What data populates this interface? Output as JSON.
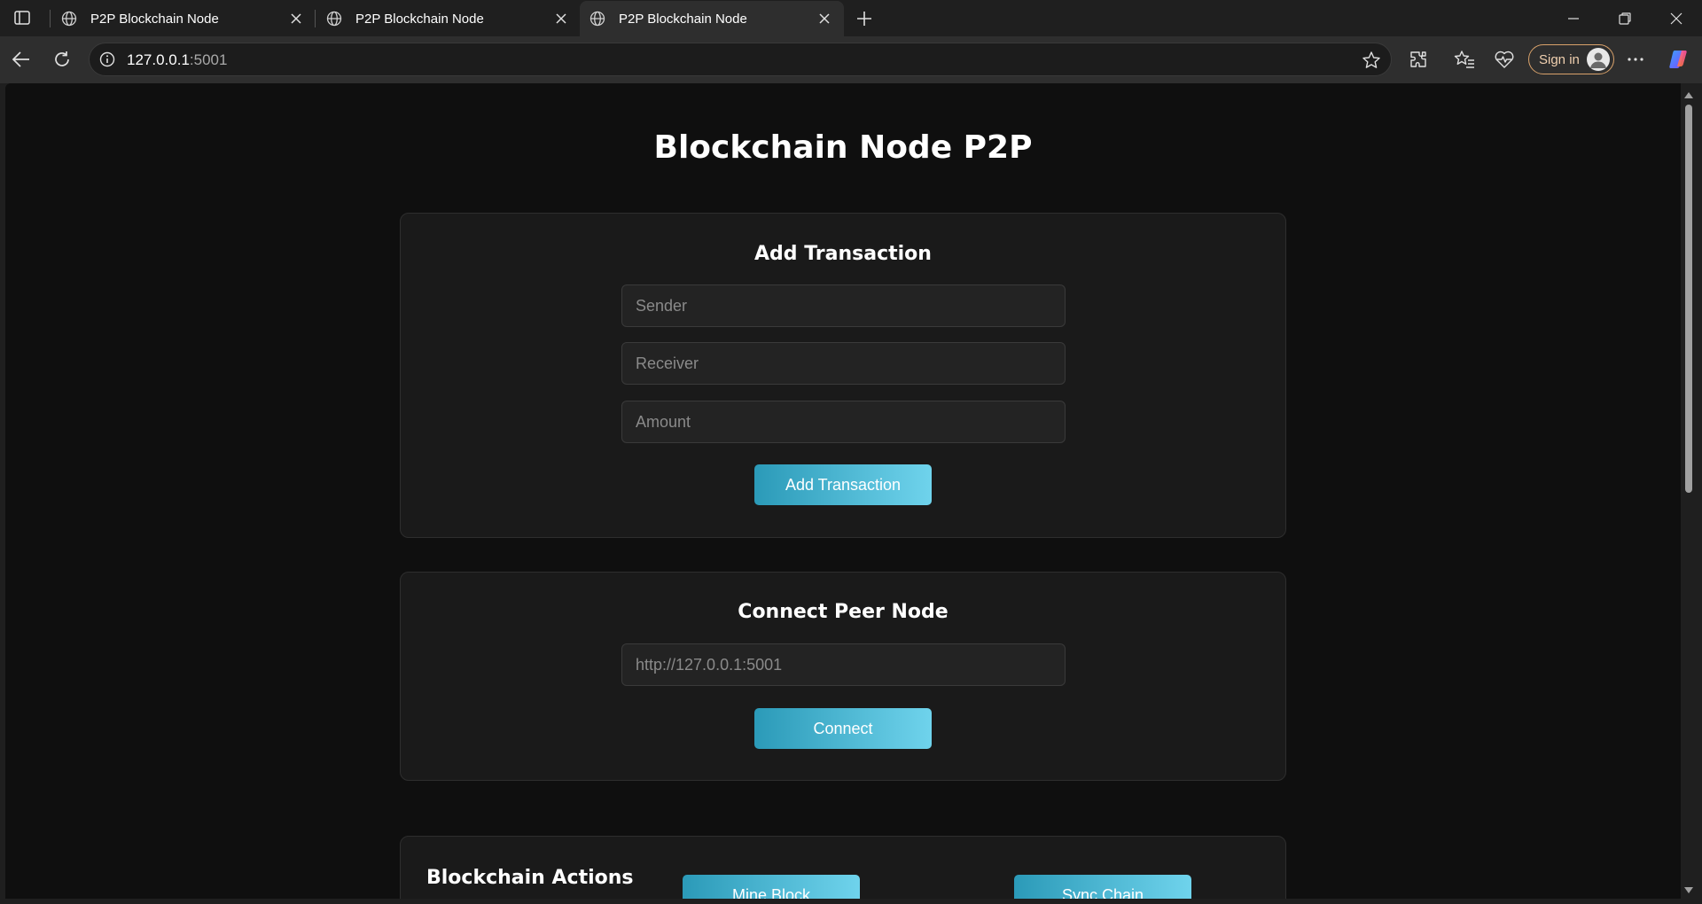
{
  "browser": {
    "tabs": [
      {
        "title": "P2P Blockchain Node",
        "active": false
      },
      {
        "title": "P2P Blockchain Node",
        "active": false
      },
      {
        "title": "P2P Blockchain Node",
        "active": true
      }
    ],
    "url_host": "127.0.0.1",
    "url_port": ":5001",
    "signin_label": "Sign in",
    "icons": [
      "sidebar-toggle-icon",
      "globe-icon",
      "close-icon",
      "plus-icon",
      "minimize-icon",
      "restore-icon",
      "back-icon",
      "refresh-icon",
      "info-icon",
      "star-icon",
      "extensions-icon",
      "favorites-icon",
      "browser-essentials-icon",
      "more-icon",
      "copilot-icon"
    ]
  },
  "page": {
    "title": "Blockchain Node P2P",
    "add_transaction": {
      "heading": "Add Transaction",
      "sender_placeholder": "Sender",
      "receiver_placeholder": "Receiver",
      "amount_placeholder": "Amount",
      "button": "Add Transaction"
    },
    "connect_peer": {
      "heading": "Connect Peer Node",
      "peer_placeholder": "http://127.0.0.1:5001",
      "button": "Connect"
    },
    "actions": {
      "heading": "Blockchain Actions",
      "mine_button": "Mine Block",
      "sync_button": "Sync Chain"
    }
  },
  "colors": {
    "page_bg": "#0f0f0f",
    "card_bg": "#1a1a1a",
    "button_gradient_start": "#2b9ab8",
    "button_gradient_end": "#6fd3ec",
    "signin_border": "#d9a26b"
  }
}
